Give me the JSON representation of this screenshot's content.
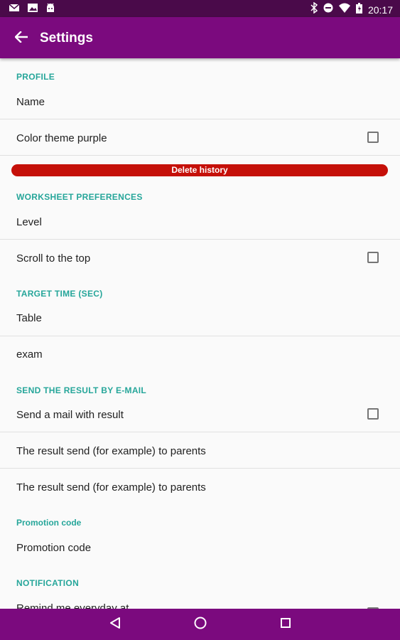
{
  "status_bar": {
    "time": "20:17",
    "icons_left": [
      "mail-icon",
      "image-icon",
      "android-icon"
    ],
    "icons_right": [
      "bluetooth-icon",
      "do-not-disturb-icon",
      "wifi-icon",
      "battery-icon"
    ]
  },
  "app_bar": {
    "title": "Settings",
    "back_icon": "arrow-back-icon",
    "color": "#7b0a7e"
  },
  "sections": {
    "profile": {
      "header": "PROFILE",
      "name_label": "Name",
      "color_theme_label": "Color theme purple",
      "color_theme_checked": false
    },
    "delete_history_label": "Delete history",
    "worksheet": {
      "header": "WORKSHEET PREFERENCES",
      "level_label": "Level",
      "scroll_top_label": "Scroll to the top",
      "scroll_top_checked": false
    },
    "target_time": {
      "header": "TARGET TIME (SEC)",
      "table_label": "Table",
      "exam_label": "exam"
    },
    "email": {
      "header": "SEND THE RESULT BY E-MAIL",
      "send_mail_label": "Send a mail with result",
      "send_mail_checked": false,
      "result_send_1": "The result send (for example) to parents",
      "result_send_2": "The result send (for example) to parents"
    },
    "promotion": {
      "header": "Promotion code",
      "code_label": "Promotion code"
    },
    "notification": {
      "header": "NOTIFICATION",
      "remind_label": "Remind me everyday at"
    }
  },
  "colors": {
    "accent": "#26a69a",
    "delete": "#c51009",
    "nav": "#7b0a7e"
  },
  "nav_bar": {
    "icons": [
      "back-triangle-icon",
      "home-circle-icon",
      "recents-square-icon"
    ]
  }
}
